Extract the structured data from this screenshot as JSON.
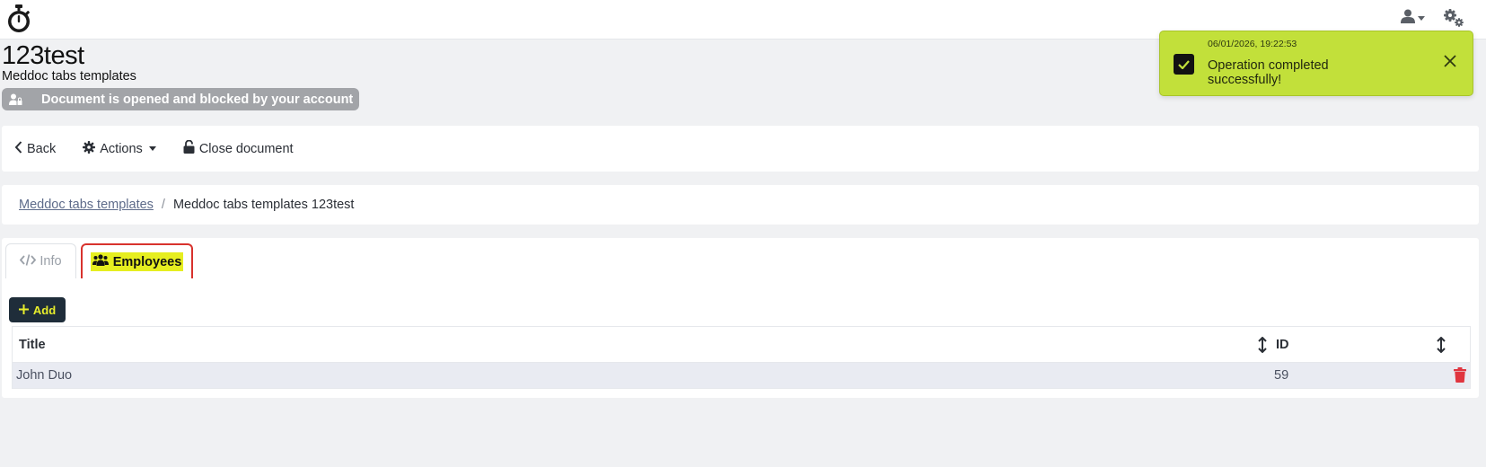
{
  "header": {
    "logo_icon": "stopwatch-icon",
    "user_icon": "user-icon",
    "settings_icon": "gears-icon"
  },
  "document": {
    "title": "123test",
    "subtitle": "Meddoc tabs templates",
    "lock_message": "Document is opened and blocked by your account",
    "lock_icon": "user-lock-icon"
  },
  "toolbar": {
    "back_label": "Back",
    "actions_label": "Actions",
    "close_label": "Close document"
  },
  "breadcrumb": {
    "parent": "Meddoc tabs templates",
    "separator": "/",
    "current": "Meddoc tabs templates 123test"
  },
  "tabs": [
    {
      "label": "Info",
      "icon": "code-icon",
      "active": false
    },
    {
      "label": "Employees",
      "icon": "users-icon",
      "active": true
    }
  ],
  "add_label": "Add",
  "table": {
    "columns": [
      "Title",
      "ID"
    ],
    "rows": [
      {
        "title": "John Duo",
        "id": "59"
      }
    ]
  },
  "toast": {
    "timestamp": "06/01/2026, 19:22:53",
    "message": "Operation completed successfully!",
    "color": "#c2e03a"
  },
  "colors": {
    "accent_yellow": "#e6ee20",
    "tab_active_border": "#d8322d",
    "delete_red": "#e0353f",
    "add_button_bg": "#1f2d3a"
  }
}
